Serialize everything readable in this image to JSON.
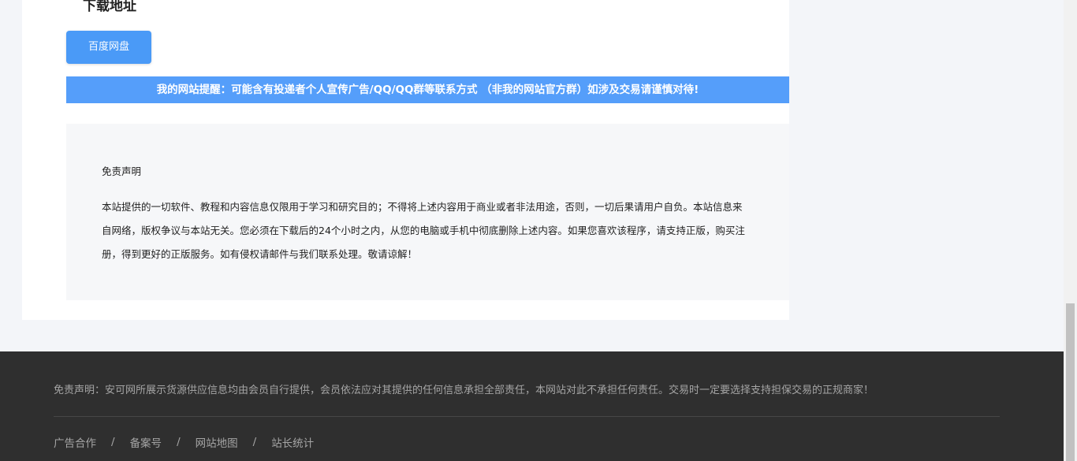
{
  "download": {
    "section_title": "下载地址",
    "button_label": "百度网盘"
  },
  "notice": {
    "text": "我的网站提醒：可能含有投递者个人宣传广告/QQ/QQ群等联系方式 （非我的网站官方群）如涉及交易请谨慎对待!"
  },
  "disclaimer": {
    "title": "免责声明",
    "body": "本站提供的一切软件、教程和内容信息仅限用于学习和研究目的；不得将上述内容用于商业或者非法用途，否则，一切后果请用户自负。本站信息来自网络，版权争议与本站无关。您必须在下载后的24个小时之内，从您的电脑或手机中彻底删除上述内容。如果您喜欢该程序，请支持正版，购买注册，得到更好的正版服务。如有侵权请邮件与我们联系处理。敬请谅解！"
  },
  "footer": {
    "disclaimer": "免责声明：安可网所展示货源供应信息均由会员自行提供，会员依法应对其提供的任何信息承担全部责任，本网站对此不承担任何责任。交易时一定要选择支持担保交易的正规商家！",
    "links": [
      "广告合作",
      "备案号",
      "网站地图",
      "站长统计"
    ],
    "separator": "/"
  },
  "colors": {
    "accent": "#4a9af7",
    "notice_bg": "#559efa",
    "footer_bg": "#2f2f2f",
    "footer_text": "#a5a5a5"
  }
}
